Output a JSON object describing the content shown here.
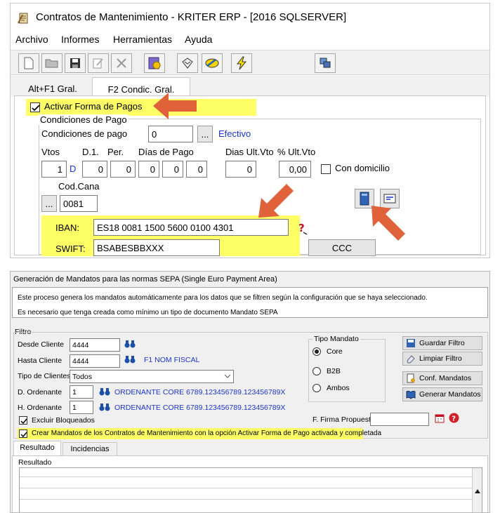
{
  "window1": {
    "title": "Contratos de Mantenimiento - KRITER ERP - [2016 SQLSERVER]",
    "menu": [
      "Archivo",
      "Informes",
      "Herramientas",
      "Ayuda"
    ],
    "toolbar_icons": [
      "new-document-icon",
      "open-folder-icon",
      "save-icon",
      "edit-icon",
      "delete-icon",
      "report-icon",
      "print-icon",
      "preview-icon",
      "lightning-icon",
      "export-icon"
    ],
    "tabs": [
      "Alt+F1 Gral.",
      "F2 Condic. Gral."
    ],
    "active_tab": 1,
    "activar_label": "Activar Forma de Pagos",
    "condiciones_title": "Condiciones de Pago",
    "condiciones_pago_label": "Condiciones de pago",
    "condiciones_pago_value": "0",
    "ellipsis": "...",
    "efectivo": "Efectivo",
    "col_vtos": "Vtos",
    "col_d1": "D.1.",
    "col_per": "Per.",
    "col_dias_pago": "Días de Pago",
    "col_dias_ult": "Dias Ult.Vto",
    "col_pct_ult": "% Ult.Vto",
    "vtos_value": "1",
    "vtos_unit": "D",
    "d1_value": "0",
    "per_value": "0",
    "dias_pago": [
      "0",
      "0",
      "0"
    ],
    "dias_ult_value": "0",
    "pct_ult_value": "0,00",
    "con_domicilio": "Con domicilio",
    "cod_cana_label": "Cod.Cana",
    "cod_cana_value": "0081",
    "iban_label": "IBAN:",
    "iban_value": "ES18 0081 1500 5600 0100 4301",
    "swift_label": "SWIFT:",
    "swift_value": "BSABESBBXXX",
    "ccc_button": "CCC"
  },
  "window2": {
    "title": "Generación de Mandatos para las normas SEPA (Single Euro Payment Area)",
    "info_line1": "Este proceso genera los mandatos automáticamente para los datos que se filtren según la configuración que se haya seleccionado.",
    "info_line2": "Es necesario que tenga creada como mínimo un tipo de documento Mandato SEPA",
    "filtro_label": "Filtro",
    "desde_cliente_label": "Desde Cliente",
    "desde_cliente_value": "4444",
    "hasta_cliente_label": "Hasta Cliente",
    "hasta_cliente_value": "4444",
    "f1_nom_fiscal": "F1 NOM FISCAL",
    "tipo_clientes_label": "Tipo de Clientes",
    "tipo_clientes_value": "Todos",
    "d_ordenante_label": "D. Ordenante",
    "d_ordenante_value": "1",
    "ordenante_desc": "ORDENANTE CORE 6789.123456789.123456789X",
    "h_ordenante_label": "H. Ordenante",
    "h_ordenante_value": "1",
    "ordenante_desc2": "ORDENANTE CORE 6789.123456789.123456789X",
    "excluir_bloqueados": "Excluir Bloqueados",
    "crear_mandatos": "Crear Mandatos de los Contratos de Mantenimiento con la opción Activar Forma de Pago activada y completada",
    "tipo_mandato_label": "Tipo Mandato",
    "radio_core": "Core",
    "radio_b2b": "B2B",
    "radio_ambos": "Ambos",
    "f_firma_label": "F. Firma Propuesta",
    "f_firma_value": "",
    "btn_guardar": "Guardar Filtro",
    "btn_limpiar": "Limpiar Filtro",
    "btn_conf": "Conf. Mandatos",
    "btn_generar": "Generar Mandatos",
    "tabs": [
      "Resultado",
      "Incidencias"
    ],
    "resultado_label": "Resultado"
  },
  "colors": {
    "highlight": "#ffff66",
    "arrow": "#e0623a",
    "link_blue": "#1c35c8"
  }
}
